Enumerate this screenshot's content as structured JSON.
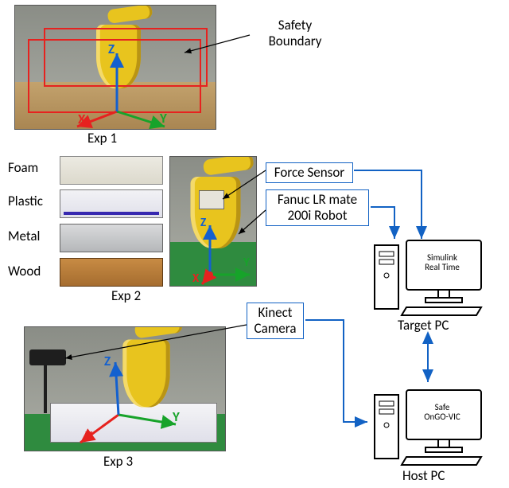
{
  "annotations": {
    "safety_boundary": "Safety\nBoundary",
    "force_sensor": "Force Sensor",
    "robot_model": "Fanuc LR mate\n200i Robot",
    "kinect": "Kinect\nCamera",
    "target_pc_screen": "Simulink\nReal Time",
    "target_pc_label": "Target PC",
    "host_pc_screen": "Safe\nOnGO-VIC",
    "host_pc_label": "Host PC"
  },
  "materials": {
    "foam": "Foam",
    "plastic": "Plastic",
    "metal": "Metal",
    "wood": "Wood"
  },
  "captions": {
    "exp1": "Exp 1",
    "exp2": "Exp 2",
    "exp3": "Exp 3"
  },
  "axes": {
    "x": "X",
    "y": "Y",
    "z": "Z"
  },
  "colors": {
    "arrow_blue": "#1262c4",
    "axis_red": "#e6221f",
    "axis_green": "#17a32a",
    "axis_blue": "#1360cf"
  }
}
